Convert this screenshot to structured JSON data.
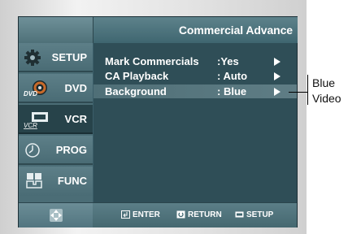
{
  "header": {
    "title": "Commercial Advance"
  },
  "sidebar": {
    "items": [
      {
        "label": "SETUP",
        "icon": "gear-icon",
        "selected": false
      },
      {
        "label": "DVD",
        "icon": "dvd-disc-icon",
        "icon_text": "DVD",
        "selected": false
      },
      {
        "label": "VCR",
        "icon": "vcr-icon",
        "icon_text": "VCR",
        "selected": true
      },
      {
        "label": "PROG",
        "icon": "clock-icon",
        "selected": false
      },
      {
        "label": "FUNC",
        "icon": "function-icon",
        "selected": false
      }
    ]
  },
  "menu": {
    "rows": [
      {
        "label": "Mark Commercials",
        "value": ":Yes",
        "highlighted": false
      },
      {
        "label": "CA Playback",
        "value": ": Auto",
        "highlighted": false
      },
      {
        "label": "Background",
        "value": ": Blue",
        "highlighted": true
      }
    ]
  },
  "bottom": {
    "hints": [
      {
        "label": "ENTER",
        "icon": "enter-icon"
      },
      {
        "label": "RETURN",
        "icon": "return-icon"
      },
      {
        "label": "SETUP",
        "icon": "setup-icon"
      }
    ]
  },
  "callout": {
    "line1": "Blue",
    "line2": "Video"
  },
  "colors": {
    "screen_bg": "#3b5e69",
    "selected_item": "#27434a",
    "highlight_row": "#5f7d85",
    "text": "#ffffff"
  }
}
